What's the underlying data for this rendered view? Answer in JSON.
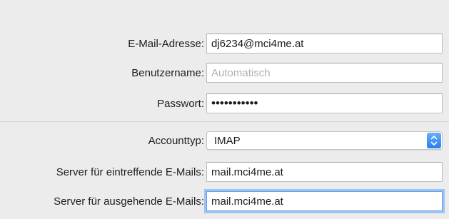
{
  "form": {
    "email": {
      "label": "E-Mail-Adresse:",
      "value": "dj6234@mci4me.at"
    },
    "username": {
      "label": "Benutzername:",
      "value": "",
      "placeholder": "Automatisch"
    },
    "password": {
      "label": "Passwort:",
      "value": "•••••••••••"
    },
    "account_type": {
      "label": "Accounttyp:",
      "selected": "IMAP"
    },
    "incoming_server": {
      "label": "Server für eintreffende E-Mails:",
      "value": "mail.mci4me.at"
    },
    "outgoing_server": {
      "label": "Server für ausgehende E-Mails:",
      "value": "mail.mci4me.at"
    }
  },
  "colors": {
    "background": "#ececec",
    "focus_ring": "#9cc3f3",
    "popup_accent": "#2a7ef0"
  },
  "icons": {
    "popup_arrows": "up-down-chevron-icon"
  }
}
